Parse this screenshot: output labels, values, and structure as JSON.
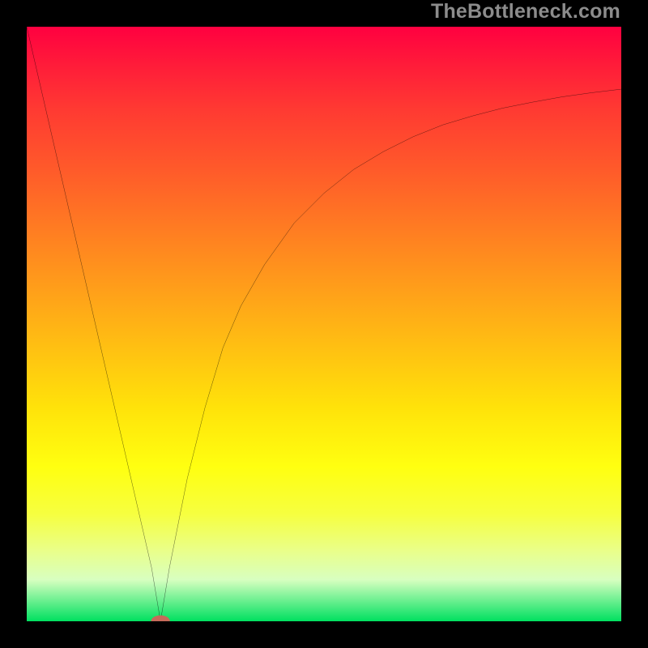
{
  "watermark": {
    "text": "TheBottleneck.com"
  },
  "chart_data": {
    "type": "line",
    "title": "",
    "xlabel": "",
    "ylabel": "",
    "xlim": [
      0,
      100
    ],
    "ylim": [
      0,
      100
    ],
    "grid": false,
    "series": [
      {
        "name": "curve",
        "x": [
          0,
          3,
          6,
          9,
          12,
          15,
          18,
          21,
          22.5,
          24,
          27,
          30,
          33,
          36,
          40,
          45,
          50,
          55,
          60,
          65,
          70,
          75,
          80,
          85,
          90,
          95,
          100
        ],
        "y": [
          100,
          87,
          74,
          61,
          48,
          35,
          22,
          9,
          0,
          9,
          24,
          36,
          46,
          53,
          60,
          67,
          72,
          76,
          79,
          81.5,
          83.5,
          85,
          86.3,
          87.3,
          88.2,
          88.9,
          89.5
        ]
      }
    ],
    "marker": {
      "x": 22.5,
      "y": 0,
      "rx": 1.6,
      "ry": 1.0,
      "color": "#c76a5a"
    },
    "gradient_colors": [
      "#ff0040",
      "#ff7c22",
      "#ffff10",
      "#00e060"
    ]
  }
}
